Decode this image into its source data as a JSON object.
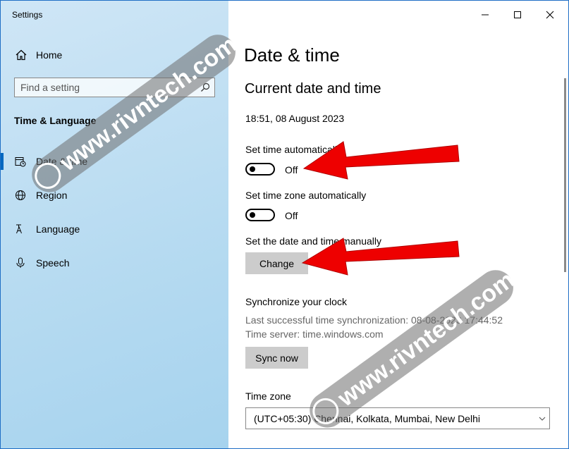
{
  "app": {
    "title": "Settings"
  },
  "sidebar": {
    "home_label": "Home",
    "search_placeholder": "Find a setting",
    "section_title": "Time & Language",
    "items": [
      {
        "label": "Date & time",
        "icon": "calendar-clock-icon",
        "active": true
      },
      {
        "label": "Region",
        "icon": "globe-icon",
        "active": false
      },
      {
        "label": "Language",
        "icon": "language-icon",
        "active": false
      },
      {
        "label": "Speech",
        "icon": "microphone-icon",
        "active": false
      }
    ]
  },
  "main": {
    "page_title": "Date & time",
    "section_heading": "Current date and time",
    "current_datetime": "18:51, 08 August 2023",
    "set_time_auto": {
      "label": "Set time automatically",
      "state": "Off"
    },
    "set_tz_auto": {
      "label": "Set time zone automatically",
      "state": "Off"
    },
    "manual": {
      "label": "Set the date and time manually",
      "button": "Change"
    },
    "sync": {
      "heading": "Synchronize your clock",
      "last_sync": "Last successful time synchronization: 08-08-2023 17:44:52",
      "server": "Time server: time.windows.com",
      "button": "Sync now"
    },
    "timezone": {
      "label": "Time zone",
      "value": "(UTC+05:30) Chennai, Kolkata, Mumbai, New Delhi"
    }
  },
  "overlay": {
    "watermark_text": "www.rivntech.com",
    "arrow_color": "#ee0000"
  },
  "colors": {
    "accent": "#0067c0",
    "sidebar_bg": "#b7dbf1",
    "button_bg": "#cccccc"
  }
}
